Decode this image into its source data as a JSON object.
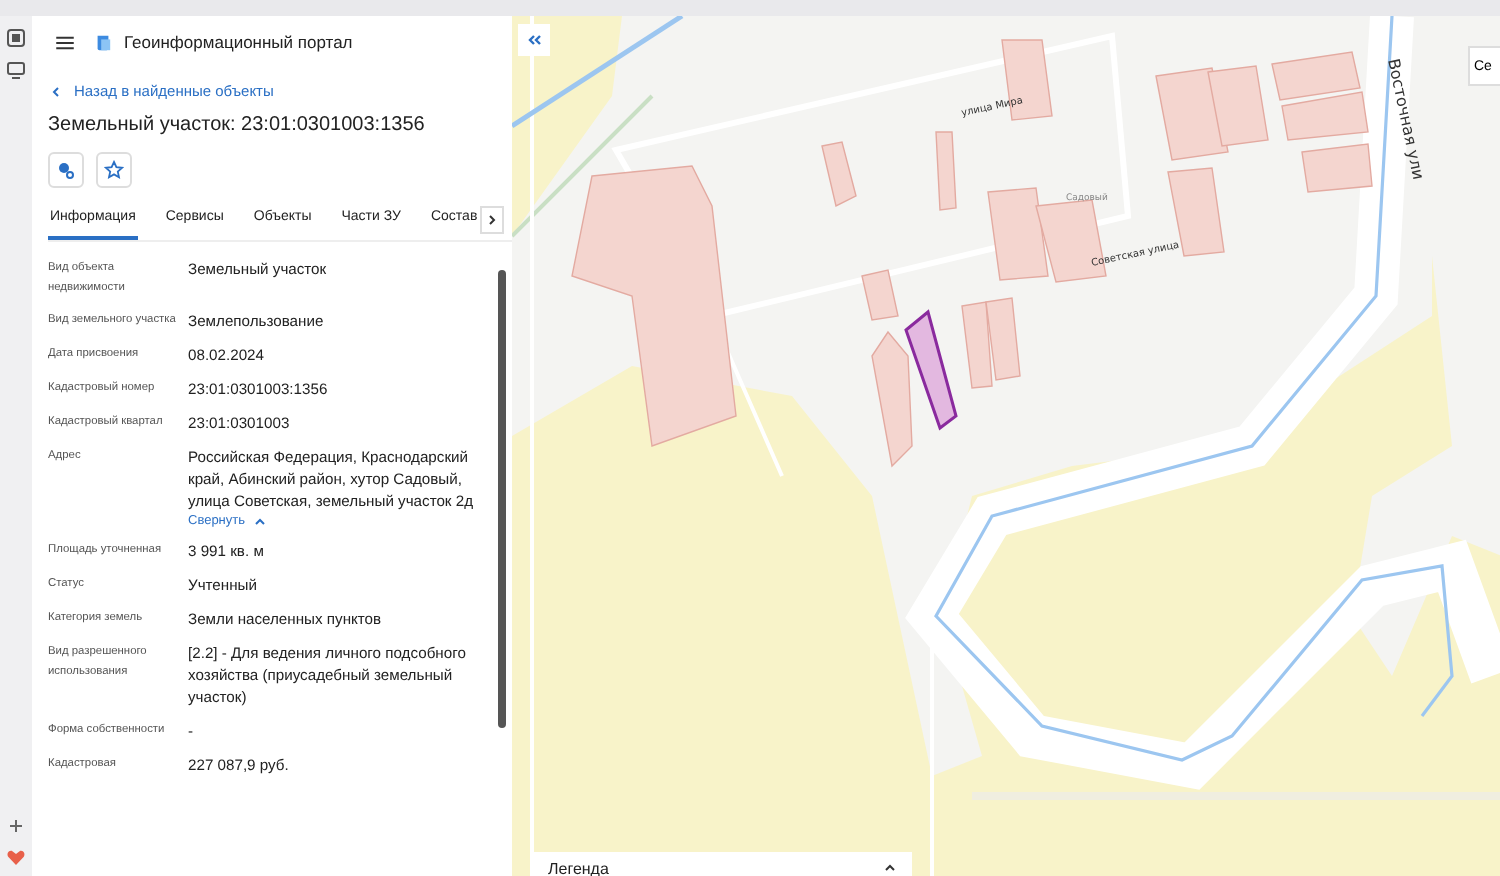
{
  "header": {
    "title": "Геоинформационный портал"
  },
  "back_link": "Назад в найденные объекты",
  "object_title": "Земельный участок: 23:01:0301003:1356",
  "tabs": [
    {
      "label": "Информация",
      "selected": true
    },
    {
      "label": "Сервисы",
      "selected": false
    },
    {
      "label": "Объекты",
      "selected": false
    },
    {
      "label": "Части ЗУ",
      "selected": false
    },
    {
      "label": "Состав",
      "selected": false
    }
  ],
  "properties": [
    {
      "label": "Вид объекта недвижимости",
      "value": "Земельный участок"
    },
    {
      "label": "Вид земельного участка",
      "value": "Землепользование"
    },
    {
      "label": "Дата присвоения",
      "value": "08.02.2024"
    },
    {
      "label": "Кадастровый номер",
      "value": "23:01:0301003:1356"
    },
    {
      "label": "Кадастровый квартал",
      "value": "23:01:0301003"
    },
    {
      "label": "Адрес",
      "value": "Российская Федерация, Краснодарский край, Абинский район, хутор Садовый, улица Советская, земельный участок 2д",
      "link": "Свернуть"
    },
    {
      "label": "Площадь уточненная",
      "value": "3 991 кв. м"
    },
    {
      "label": "Статус",
      "value": "Учтенный"
    },
    {
      "label": "Категория земель",
      "value": "Земли населенных пунктов"
    },
    {
      "label": "Вид разрешенного использования",
      "value": "[2.2] - Для ведения личного подсобного хозяйства (приусадебный земельный участок)"
    },
    {
      "label": "Форма собственности",
      "value": "-"
    },
    {
      "label": "Кадастровая",
      "value": "227 087,9 руб."
    }
  ],
  "map": {
    "labels": [
      {
        "kind": "street",
        "text": "улица Мира"
      },
      {
        "kind": "street",
        "text": "Восточная ули"
      },
      {
        "kind": "place",
        "text": "Садовый"
      },
      {
        "kind": "street",
        "text": "Советская улица"
      }
    ],
    "right_button": "Се",
    "legend": {
      "title": "Легенда",
      "expanded": true
    }
  }
}
